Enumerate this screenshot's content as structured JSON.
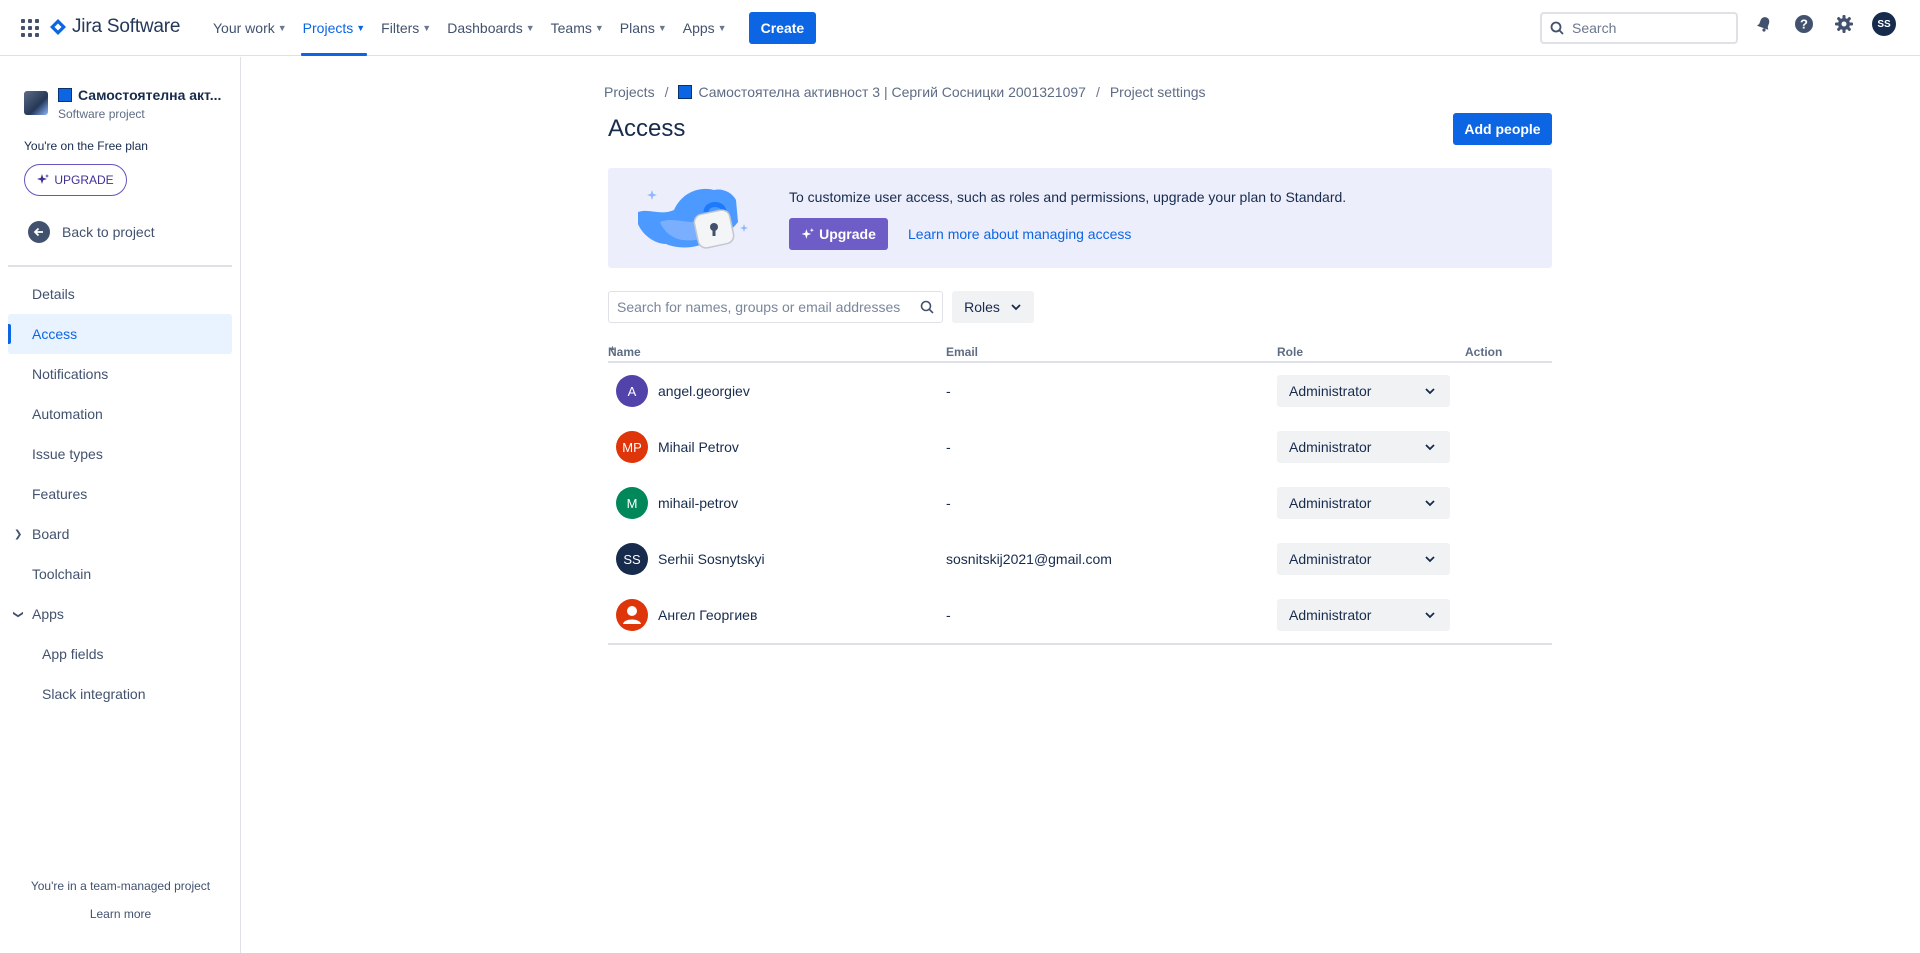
{
  "topnav": {
    "brand": "Jira Software",
    "items": [
      {
        "label": "Your work",
        "active": false
      },
      {
        "label": "Projects",
        "active": true
      },
      {
        "label": "Filters",
        "active": false
      },
      {
        "label": "Dashboards",
        "active": false
      },
      {
        "label": "Teams",
        "active": false
      },
      {
        "label": "Plans",
        "active": false
      },
      {
        "label": "Apps",
        "active": false
      }
    ],
    "create_label": "Create",
    "search_placeholder": "Search",
    "user_initials": "SS"
  },
  "sidebar": {
    "project_name": "Самостоятелна акт...",
    "project_type": "Software project",
    "plan_note": "You're on the Free plan",
    "upgrade_label": "UPGRADE",
    "back_label": "Back to project",
    "items": [
      {
        "label": "Details"
      },
      {
        "label": "Access"
      },
      {
        "label": "Notifications"
      },
      {
        "label": "Automation"
      },
      {
        "label": "Issue types"
      },
      {
        "label": "Features"
      },
      {
        "label": "Board"
      },
      {
        "label": "Toolchain"
      },
      {
        "label": "Apps"
      },
      {
        "label": "App fields"
      },
      {
        "label": "Slack integration"
      }
    ],
    "footer_text": "You're in a team-managed project",
    "footer_link": "Learn more"
  },
  "breadcrumb": {
    "projects": "Projects",
    "project": "Самостоятелна активност 3 | Сергий Сосницки 2001321097",
    "current": "Project settings"
  },
  "page": {
    "title": "Access",
    "add_people_label": "Add people"
  },
  "banner": {
    "text": "To customize user access, such as roles and permissions, upgrade your plan to Standard.",
    "upgrade_label": "Upgrade",
    "link_label": "Learn more about managing access"
  },
  "filters": {
    "search_placeholder": "Search for names, groups or email addresses",
    "roles_label": "Roles"
  },
  "table": {
    "headers": {
      "name": "Name",
      "email": "Email",
      "role": "Role",
      "action": "Action"
    },
    "rows": [
      {
        "initials": "A",
        "name": "angel.georgiev",
        "email": "-",
        "role": "Administrator",
        "color": "#5243aa"
      },
      {
        "initials": "MP",
        "name": "Mihail Petrov",
        "email": "-",
        "role": "Administrator",
        "color": "#de350b"
      },
      {
        "initials": "M",
        "name": "mihail-petrov",
        "email": "-",
        "role": "Administrator",
        "color": "#00875a"
      },
      {
        "initials": "SS",
        "name": "Serhii Sosnytskyi",
        "email": "sosnitskij2021@gmail.com",
        "role": "Administrator",
        "color": "#172b4d"
      },
      {
        "initials": "",
        "name": "Ангел Георгиев",
        "email": "-",
        "role": "Administrator",
        "color": "#de350b"
      }
    ]
  },
  "colors": {
    "brand_blue": "#0c66e4",
    "discovery_purple": "#6e5dc6",
    "banner_bg": "#edeefc"
  }
}
